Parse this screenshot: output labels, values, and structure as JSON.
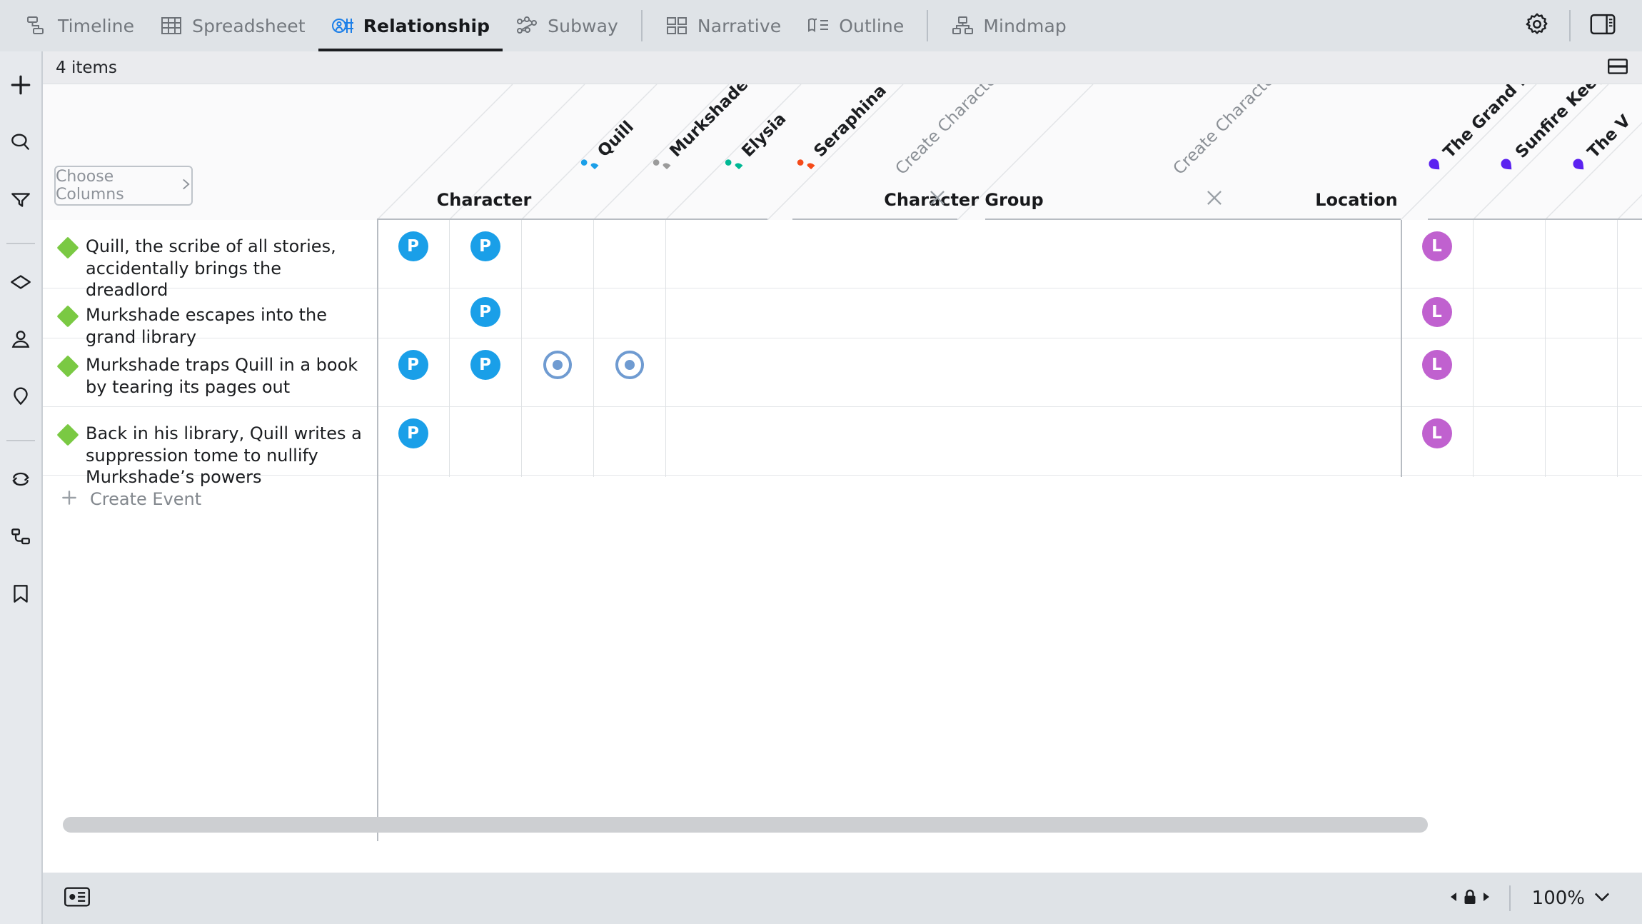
{
  "toolbar": {
    "tabs": [
      {
        "label": "Timeline",
        "icon": "timeline-icon",
        "active": false
      },
      {
        "label": "Spreadsheet",
        "icon": "spreadsheet-icon",
        "active": false
      },
      {
        "label": "Relationship",
        "icon": "relationship-icon",
        "active": true
      },
      {
        "label": "Subway",
        "icon": "subway-icon",
        "active": false
      },
      {
        "label": "Narrative",
        "icon": "narrative-icon",
        "active": false
      },
      {
        "label": "Outline",
        "icon": "outline-icon",
        "active": false
      },
      {
        "label": "Mindmap",
        "icon": "mindmap-icon",
        "active": false
      }
    ],
    "settings_icon": "gear-icon",
    "panel_icon": "right-panel-icon"
  },
  "rail": {
    "items": [
      {
        "icon": "plus-icon",
        "name": "add-button"
      },
      {
        "icon": "search-icon",
        "name": "search-button"
      },
      {
        "icon": "filter-icon",
        "name": "filter-button"
      },
      {
        "icon": "diamond-icon",
        "name": "events-button"
      },
      {
        "icon": "person-icon",
        "name": "characters-button"
      },
      {
        "icon": "location-pin-icon",
        "name": "locations-button"
      },
      {
        "icon": "arcs-icon",
        "name": "arcs-button"
      },
      {
        "icon": "relationships-icon",
        "name": "relationships-button"
      },
      {
        "icon": "bookmark-icon",
        "name": "bookmarks-button"
      }
    ]
  },
  "items_bar": {
    "count_label": "4 items",
    "layout_icon": "split-rows-icon"
  },
  "grid": {
    "choose_columns_label": "Choose Columns",
    "choose_columns_chevron": "chevron-right-icon",
    "groups": [
      {
        "title": "Character",
        "close_icon": "close-icon"
      },
      {
        "title": "Character Group",
        "close_icon": "close-icon"
      },
      {
        "title": "Location",
        "close_icon": "close-icon"
      }
    ],
    "columns": [
      {
        "label": "Quill",
        "type": "character",
        "color": "#1a9fe8",
        "group": "Character"
      },
      {
        "label": "Murkshade",
        "type": "character",
        "color": "#9b9b9b",
        "group": "Character"
      },
      {
        "label": "Elysia",
        "type": "character",
        "color": "#00b894",
        "group": "Character"
      },
      {
        "label": "Seraphina",
        "type": "character",
        "color": "#f54a19",
        "group": "Character"
      },
      {
        "label": "Create Character",
        "type": "create",
        "color": "#8b9096",
        "group": "Character"
      },
      {
        "label": "Create Character Group",
        "type": "create",
        "color": "#8b9096",
        "group": "Character Group"
      },
      {
        "label": "The Grand Library",
        "type": "location",
        "color": "#5b22f0",
        "group": "Location"
      },
      {
        "label": "Sunfire Keep",
        "type": "location",
        "color": "#5b22f0",
        "group": "Location"
      },
      {
        "label": "The V",
        "type": "location",
        "color": "#5b22f0",
        "group": "Location"
      }
    ],
    "rows": [
      {
        "text": "Quill, the scribe of all stories, accidentally brings the dreadlord",
        "marker_icon": "green-diamond-icon",
        "cells": [
          {
            "col": "row-head",
            "mark": "P",
            "kind": "badge",
            "color": "#1a9fe8"
          },
          {
            "col": "Quill",
            "mark": "P",
            "kind": "badge",
            "color": "#1a9fe8"
          },
          {
            "col": "loc-head",
            "mark": "L",
            "kind": "badge",
            "color": "#c061cf"
          }
        ]
      },
      {
        "text": "Murkshade escapes into the grand library",
        "marker_icon": "green-diamond-icon",
        "cells": [
          {
            "col": "Quill",
            "mark": "P",
            "kind": "badge",
            "color": "#1a9fe8"
          },
          {
            "col": "loc-head",
            "mark": "L",
            "kind": "badge",
            "color": "#c061cf"
          }
        ]
      },
      {
        "text": "Murkshade traps Quill in a book by tearing its pages out",
        "marker_icon": "green-diamond-icon",
        "cells": [
          {
            "col": "row-head",
            "mark": "P",
            "kind": "badge",
            "color": "#1a9fe8"
          },
          {
            "col": "Quill",
            "mark": "P",
            "kind": "badge",
            "color": "#1a9fe8"
          },
          {
            "col": "Murkshade",
            "mark": "",
            "kind": "ring",
            "color": "#6f9bd1"
          },
          {
            "col": "Elysia",
            "mark": "",
            "kind": "ring",
            "color": "#6f9bd1"
          },
          {
            "col": "loc-head",
            "mark": "L",
            "kind": "badge",
            "color": "#c061cf"
          }
        ]
      },
      {
        "text": "Back in his library, Quill writes a suppression tome to nullify Murkshade’s powers",
        "marker_icon": "green-diamond-icon",
        "cells": [
          {
            "col": "row-head",
            "mark": "P",
            "kind": "badge",
            "color": "#1a9fe8"
          },
          {
            "col": "loc-head",
            "mark": "L",
            "kind": "badge",
            "color": "#c061cf"
          }
        ]
      }
    ],
    "create_event_label": "Create Event",
    "create_event_icon": "plus-icon"
  },
  "footer": {
    "card_view_icon": "card-view-icon",
    "lock_icon": "lock-icon",
    "zoom_level": "100%",
    "zoom_chevron": "chevron-down-icon"
  },
  "colors": {
    "accent_blue": "#1a9fe8",
    "event_green": "#7ac943",
    "location_purple": "#c061cf",
    "pin_purple": "#5b22f0",
    "ring_blue": "#6f9bd1",
    "toolbar_bg": "#dfe3e7",
    "rail_bg": "#e6e9ed"
  }
}
